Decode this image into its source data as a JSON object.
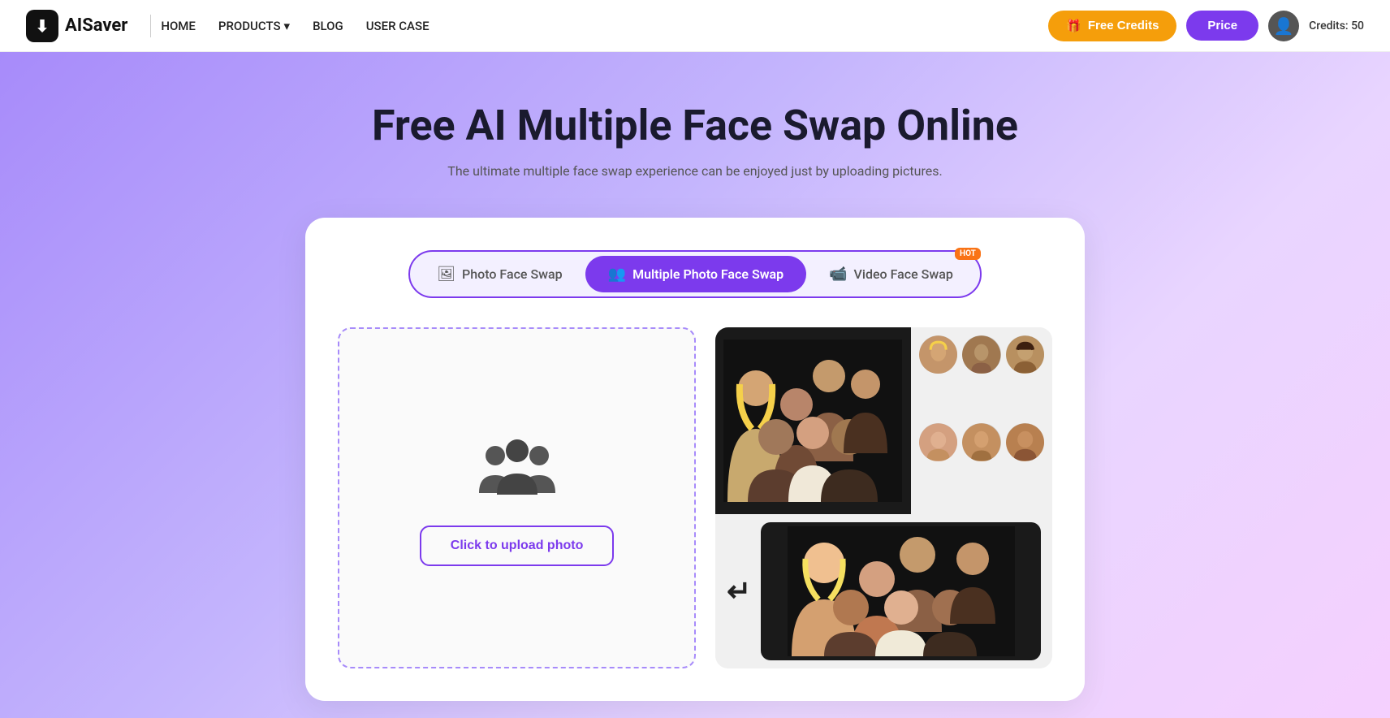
{
  "navbar": {
    "logo_text": "AISaver",
    "logo_icon": "⬇",
    "links": [
      {
        "label": "HOME",
        "has_dropdown": false
      },
      {
        "label": "PRODUCTS",
        "has_dropdown": true
      },
      {
        "label": "BLOG",
        "has_dropdown": false
      },
      {
        "label": "USER CASE",
        "has_dropdown": false
      }
    ],
    "free_credits_label": "Free Credits",
    "price_label": "Price",
    "credits_label": "Credits: 50"
  },
  "hero": {
    "title": "Free AI Multiple Face Swap Online",
    "subtitle": "The ultimate multiple face swap experience can be enjoyed just by uploading pictures."
  },
  "tabs": [
    {
      "label": "Photo Face Swap",
      "icon": "🖼",
      "active": false,
      "hot": false
    },
    {
      "label": "Multiple Photo Face Swap",
      "icon": "👥",
      "active": true,
      "hot": false
    },
    {
      "label": "Video Face Swap",
      "icon": "🎬",
      "active": false,
      "hot": true
    }
  ],
  "upload": {
    "button_label": "Click to upload photo"
  },
  "hot_badge": "HOT"
}
